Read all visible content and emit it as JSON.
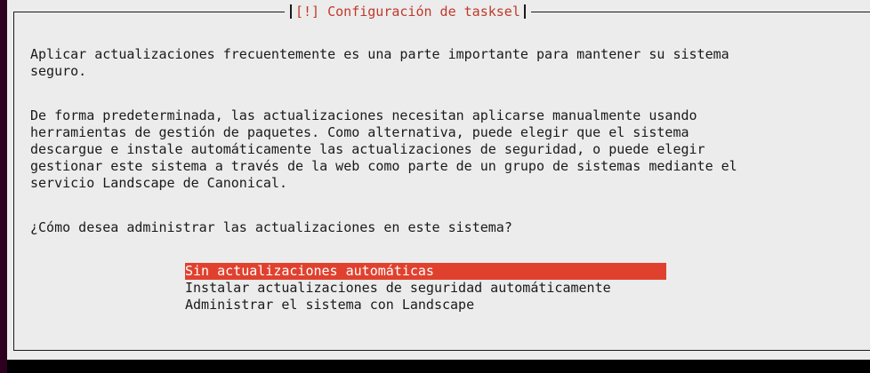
{
  "dialog": {
    "title": "[!] Configuración de tasksel",
    "paragraphs": [
      [
        "Aplicar actualizaciones frecuentemente es una parte importante para mantener su sistema",
        "seguro."
      ],
      [
        "De forma predeterminada, las actualizaciones necesitan aplicarse manualmente usando",
        "herramientas de gestión de paquetes. Como alternativa, puede elegir que el sistema",
        "descargue e instale automáticamente las actualizaciones de seguridad, o puede elegir",
        "gestionar este sistema a través de la web como parte de un grupo de sistemas mediante el",
        "servicio Landscape de Canonical."
      ],
      [
        "¿Cómo desea administrar las actualizaciones en este sistema?"
      ]
    ],
    "options": [
      {
        "label": "Sin actualizaciones automáticas",
        "selected": true
      },
      {
        "label": "Instalar actualizaciones de seguridad automáticamente",
        "selected": false
      },
      {
        "label": "Administrar el sistema con Landscape",
        "selected": false
      }
    ]
  },
  "colors": {
    "background": "#2c001e",
    "dialog_bg": "#ececec",
    "title_text": "#c0392b",
    "highlight": "#e0412e"
  }
}
